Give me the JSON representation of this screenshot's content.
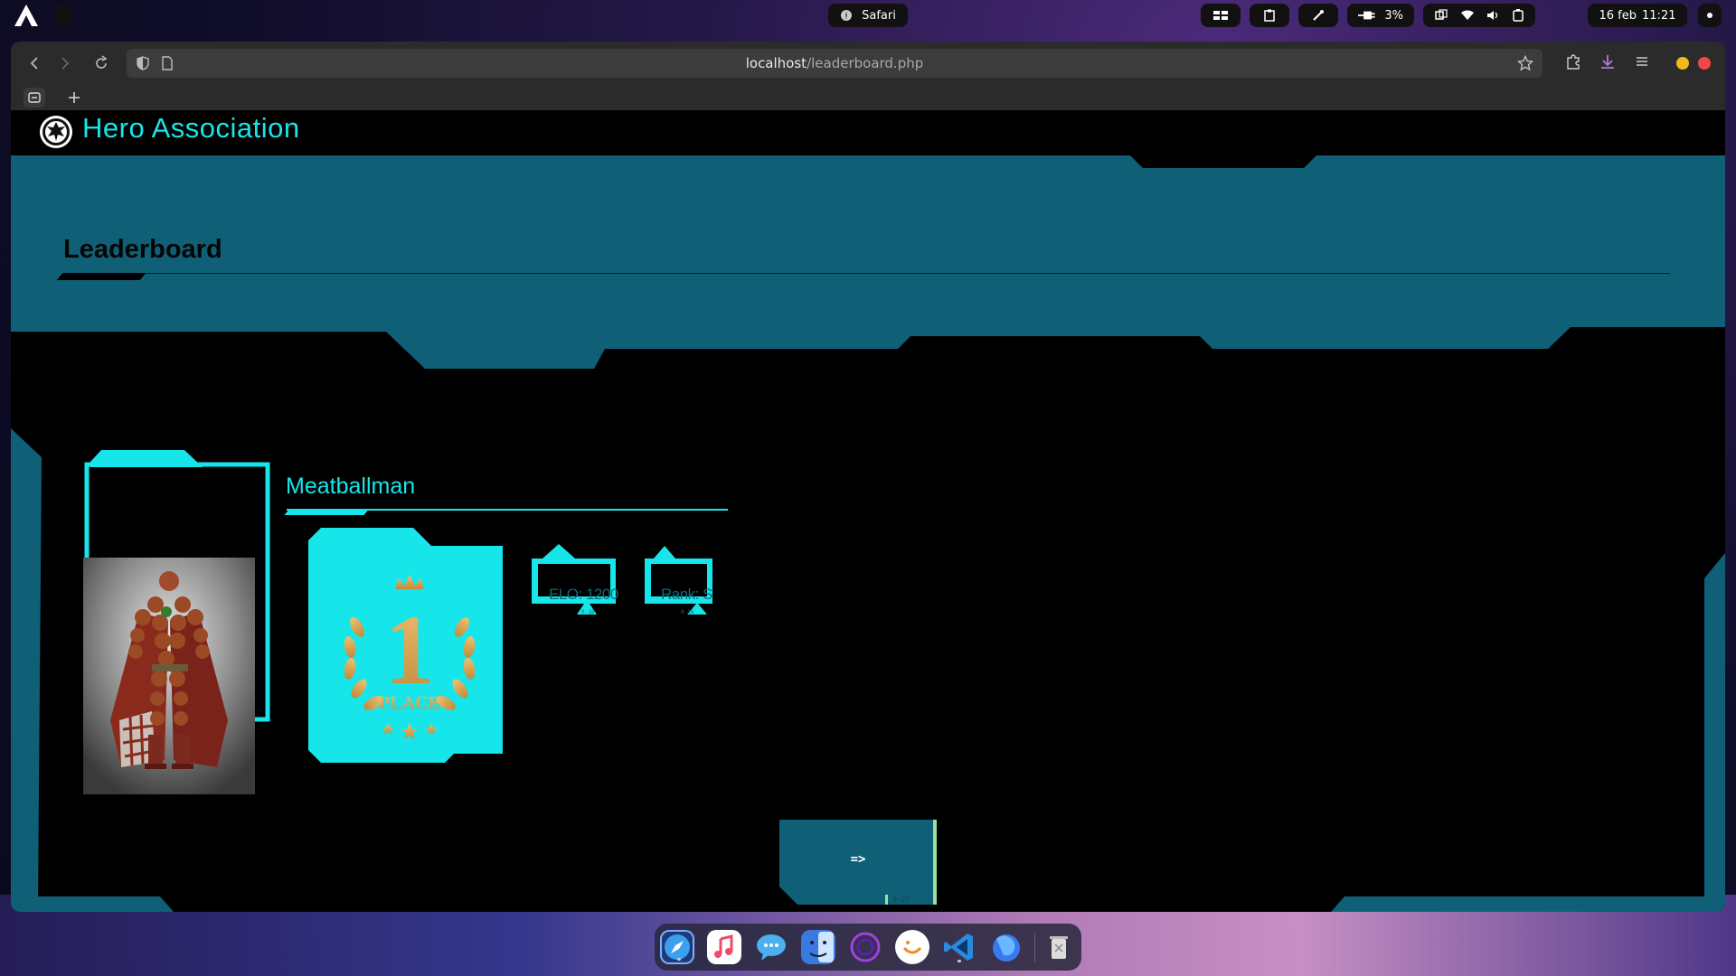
{
  "topbar": {
    "app_name": "Safari",
    "battery": "3%",
    "date": "16 feb",
    "time": "11:21"
  },
  "browser": {
    "url_host": "localhost",
    "url_path": "/leaderboard.php"
  },
  "site": {
    "title": "Hero Association"
  },
  "leaderboard": {
    "heading": "Leaderboard",
    "hero": {
      "name": "Meatballman",
      "place_number": "1",
      "place_word": "PLACE",
      "elo": "ELO: 1200",
      "rank": "Rank: S",
      "elo_tag": "0-16",
      "rank_tag": "0-16"
    },
    "next_button": "=>",
    "next_tag": "3-25"
  },
  "colors": {
    "accent": "#16e6ea",
    "band": "#0f6077",
    "background": "#000000"
  },
  "dock": {
    "apps": [
      "safari-icon",
      "music-icon",
      "messages-icon",
      "finder-icon",
      "arc-icon",
      "bitwarden-icon",
      "vscode-icon",
      "firefox-icon",
      "trash-icon"
    ]
  }
}
